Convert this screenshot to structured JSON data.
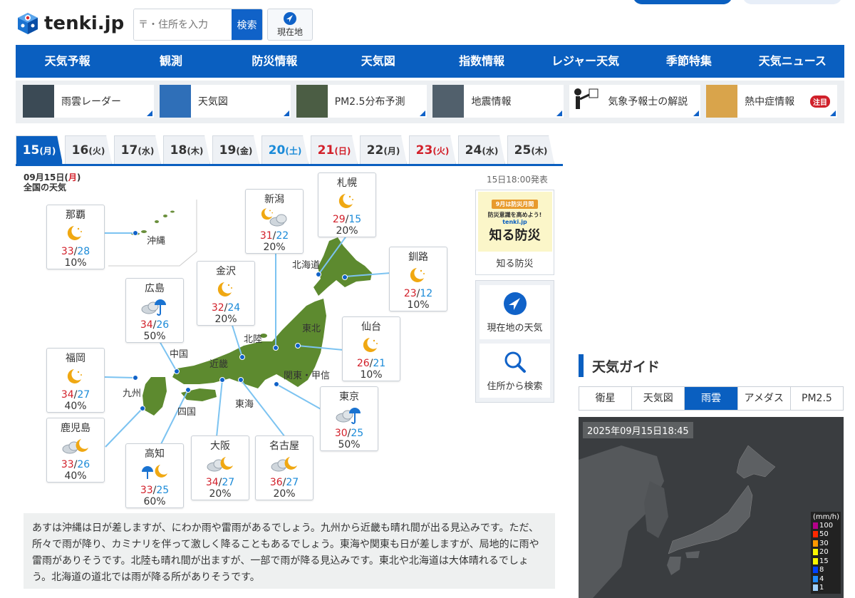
{
  "logo": {
    "text": "tenki.jp"
  },
  "search": {
    "placeholder": "〒・住所を入力",
    "button": "検索"
  },
  "current_location": {
    "label": "現在地"
  },
  "nav": [
    "天気予報",
    "観測",
    "防災情報",
    "天気図",
    "指数情報",
    "レジャー天気",
    "季節特集",
    "天気ニュース"
  ],
  "quick": [
    {
      "label": "雨雲レーダー"
    },
    {
      "label": "天気図"
    },
    {
      "label": "PM2.5分布予測"
    },
    {
      "label": "地震情報"
    },
    {
      "label": "気象予報士の解説"
    },
    {
      "label": "熱中症情報",
      "badge": "注目"
    }
  ],
  "tabs": [
    {
      "day": "15",
      "dow": "(月)",
      "kind": "active"
    },
    {
      "day": "16",
      "dow": "(火)",
      "kind": "normal"
    },
    {
      "day": "17",
      "dow": "(水)",
      "kind": "normal"
    },
    {
      "day": "18",
      "dow": "(木)",
      "kind": "normal"
    },
    {
      "day": "19",
      "dow": "(金)",
      "kind": "normal"
    },
    {
      "day": "20",
      "dow": "(土)",
      "kind": "sat"
    },
    {
      "day": "21",
      "dow": "(日)",
      "kind": "hol"
    },
    {
      "day": "22",
      "dow": "(月)",
      "kind": "normal"
    },
    {
      "day": "23",
      "dow": "(火)",
      "kind": "hol"
    },
    {
      "day": "24",
      "dow": "(水)",
      "kind": "normal"
    },
    {
      "day": "25",
      "dow": "(木)",
      "kind": "normal"
    }
  ],
  "map": {
    "date_prefix": "09月15日(",
    "date_dow": "月",
    "date_suffix": ")",
    "subtitle": "全国の天気",
    "issued": "15日18:00発表",
    "cities": [
      {
        "name": "那覇",
        "icon": "moon",
        "hi": "33",
        "lo": "28",
        "pop": "10%"
      },
      {
        "name": "新潟",
        "icon": "moon-cloud",
        "hi": "31",
        "lo": "22",
        "pop": "20%"
      },
      {
        "name": "札幌",
        "icon": "moon",
        "hi": "29",
        "lo": "15",
        "pop": "20%"
      },
      {
        "name": "釧路",
        "icon": "moon",
        "hi": "23",
        "lo": "12",
        "pop": "10%"
      },
      {
        "name": "金沢",
        "icon": "moon",
        "hi": "32",
        "lo": "24",
        "pop": "20%"
      },
      {
        "name": "広島",
        "icon": "cloud-rain",
        "hi": "34",
        "lo": "26",
        "pop": "50%"
      },
      {
        "name": "仙台",
        "icon": "moon",
        "hi": "26",
        "lo": "21",
        "pop": "10%"
      },
      {
        "name": "福岡",
        "icon": "moon",
        "hi": "34",
        "lo": "27",
        "pop": "40%"
      },
      {
        "name": "東京",
        "icon": "cloud-rain",
        "hi": "30",
        "lo": "25",
        "pop": "50%"
      },
      {
        "name": "鹿児島",
        "icon": "cloud-moon",
        "hi": "33",
        "lo": "26",
        "pop": "40%"
      },
      {
        "name": "高知",
        "icon": "rain-moon",
        "hi": "33",
        "lo": "25",
        "pop": "60%"
      },
      {
        "name": "大阪",
        "icon": "cloud-moon",
        "hi": "34",
        "lo": "27",
        "pop": "20%"
      },
      {
        "name": "名古屋",
        "icon": "cloud-moon",
        "hi": "36",
        "lo": "27",
        "pop": "20%"
      }
    ],
    "regions": [
      "沖縄",
      "北海道",
      "北陸",
      "東北",
      "中国",
      "近畿",
      "関東・甲信",
      "九州",
      "四国",
      "東海"
    ]
  },
  "bosai": {
    "banner1": "9月は防災月間",
    "banner2": "防災意識を高めよう!",
    "banner3": "tenki.jp",
    "banner4": "知る防災",
    "caption": "知る防災"
  },
  "side": {
    "current": "現在地の天気",
    "search": "住所から検索"
  },
  "description": "あすは沖縄は日が差しますが、にわか雨や雷雨があるでしょう。九州から近畿も晴れ間が出る見込みです。ただ、所々で雨が降り、カミナリを伴って激しく降ることもあるでしょう。東海や関東も日が差しますが、局地的に雨や雷雨がありそうです。北陸も晴れ間が出ますが、一部で雨が降る見込みです。東北や北海道は大体晴れるでしょう。北海道の道北では雨が降る所がありそうです。",
  "guide": {
    "title": "天気ガイド",
    "tabs": [
      "衛星",
      "天気図",
      "雨雲",
      "アメダス",
      "PM2.5"
    ],
    "active": "雨雲",
    "timestamp": "2025年09月15日18:45",
    "legend_unit": "(mm/h)",
    "legend": [
      {
        "v": "100",
        "c": "#b4008a"
      },
      {
        "v": "50",
        "c": "#ff2800"
      },
      {
        "v": "30",
        "c": "#ff9900"
      },
      {
        "v": "20",
        "c": "#faf500"
      },
      {
        "v": "15",
        "c": "#faf500"
      },
      {
        "v": "8",
        "c": "#0041ff"
      },
      {
        "v": "4",
        "c": "#218cff"
      },
      {
        "v": "1",
        "c": "#a0d2ff"
      }
    ]
  }
}
